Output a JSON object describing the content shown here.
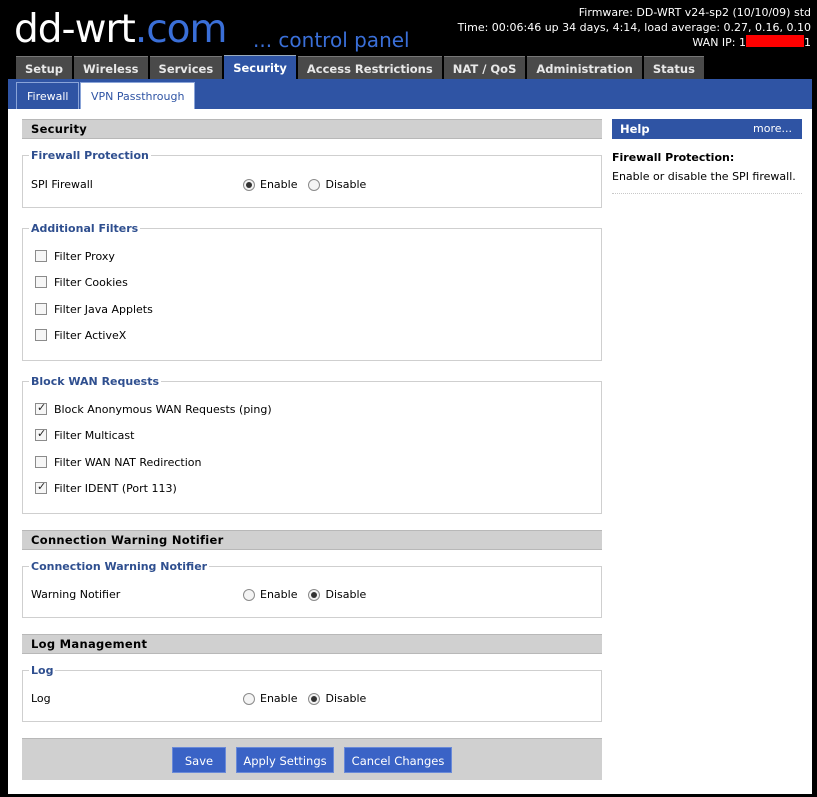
{
  "header": {
    "logo_main": "dd-wrt",
    "logo_dotcom": ".com",
    "logo_sub": "... control panel",
    "firmware": "Firmware: DD-WRT v24-sp2 (10/10/09) std",
    "time": "Time: 00:06:46 up 34 days, 4:14, load average: 0.27, 0.16, 0.10",
    "wan_ip_label": "WAN IP: ",
    "wan_ip_start": "1",
    "wan_ip_end": "1"
  },
  "main_tabs": [
    {
      "label": "Setup"
    },
    {
      "label": "Wireless"
    },
    {
      "label": "Services"
    },
    {
      "label": "Security"
    },
    {
      "label": "Access Restrictions"
    },
    {
      "label": "NAT / QoS"
    },
    {
      "label": "Administration"
    },
    {
      "label": "Status"
    }
  ],
  "active_main_tab": "Security",
  "sub_tabs": [
    {
      "label": "Firewall"
    },
    {
      "label": "VPN Passthrough"
    }
  ],
  "active_sub_tab": "Firewall",
  "security": {
    "heading": "Security",
    "firewall_protection": {
      "legend": "Firewall Protection",
      "spi_label": "SPI Firewall",
      "enable": "Enable",
      "disable": "Disable",
      "selected": "Enable"
    },
    "additional_filters": {
      "legend": "Additional Filters",
      "items": [
        {
          "label": "Filter Proxy",
          "checked": false
        },
        {
          "label": "Filter Cookies",
          "checked": false
        },
        {
          "label": "Filter Java Applets",
          "checked": false
        },
        {
          "label": "Filter ActiveX",
          "checked": false
        }
      ]
    },
    "block_wan": {
      "legend": "Block WAN Requests",
      "items": [
        {
          "label": "Block Anonymous WAN Requests (ping)",
          "checked": true
        },
        {
          "label": "Filter Multicast",
          "checked": true
        },
        {
          "label": "Filter WAN NAT Redirection",
          "checked": false
        },
        {
          "label": "Filter IDENT (Port 113)",
          "checked": true
        }
      ]
    }
  },
  "connection_warning": {
    "heading": "Connection Warning Notifier",
    "legend": "Connection Warning Notifier",
    "label": "Warning Notifier",
    "enable": "Enable",
    "disable": "Disable",
    "selected": "Disable"
  },
  "log_management": {
    "heading": "Log Management",
    "legend": "Log",
    "label": "Log",
    "enable": "Enable",
    "disable": "Disable",
    "selected": "Disable"
  },
  "buttons": {
    "save": "Save",
    "apply": "Apply Settings",
    "cancel": "Cancel Changes"
  },
  "help": {
    "title": "Help",
    "more": "more...",
    "topic": "Firewall Protection:",
    "text": "Enable or disable the SPI firewall."
  },
  "colors": {
    "accent_blue": "#2f54a4",
    "button_blue": "#3a63c6",
    "logo_blue": "#3a6fd8",
    "legend_blue": "#2f4f8f",
    "redaction": "#ff0000"
  }
}
